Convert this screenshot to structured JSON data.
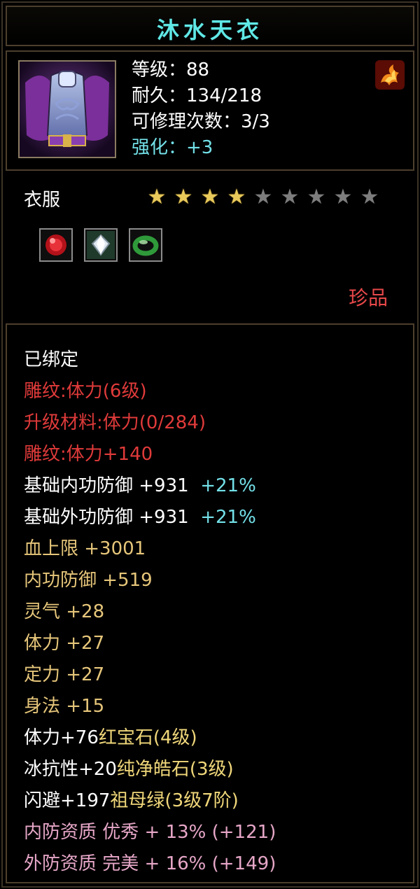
{
  "item": {
    "name": "沐水天衣",
    "level_line": "等级：88",
    "durability_line": "耐久：134/218",
    "repair_line": "可修理次数：3/3",
    "enhance_label": "强化：",
    "enhance_value": "+3",
    "type": "衣服",
    "stars": {
      "filled": 4,
      "total": 9
    },
    "rarity": "珍品",
    "gems": [
      "red-ruby-gem-icon",
      "white-diamond-gem-icon",
      "green-jade-ring-icon"
    ]
  },
  "attributes": {
    "bound": "已绑定",
    "engrave_level": "雕纹:体力(6级)",
    "upgrade_material": "升级材料:体力(0/284)",
    "engrave_bonus": "雕纹:体力+140",
    "inner_def_label": "基础内功防御 +931",
    "inner_def_pct": "+21%",
    "outer_def_label": "基础外功防御 +931",
    "outer_def_pct": "+21%",
    "hp_max": "血上限 +3001",
    "inner_def": "内功防御 +519",
    "spirit": "灵气 +28",
    "stamina": "体力 +27",
    "focus": "定力 +27",
    "agility": "身法 +15",
    "gem1_stat": "体力+76",
    "gem1_name": "红宝石(4级)",
    "gem2_stat": "冰抗性+20",
    "gem2_name": "纯净皓石(3级)",
    "gem3_stat": "闪避+197",
    "gem3_name": "祖母绿(3级7阶)",
    "inner_quality": "内防资质 优秀 + 13% (+121)",
    "outer_quality": "外防资质 完美 + 16% (+149)"
  },
  "colors": {
    "title": "#5fe8e6",
    "cyan": "#73e0e8",
    "red": "#e03a3a",
    "gold": "#e6c67a",
    "pink": "#e7a7c8",
    "star_on": "#e8c95a",
    "star_off": "#7d7d7d"
  }
}
